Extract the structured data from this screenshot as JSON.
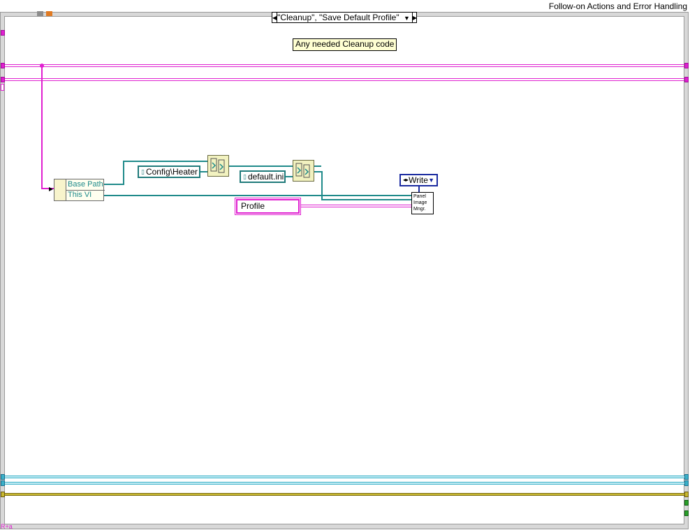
{
  "window": {
    "title": "Follow-on Actions and Error Handling"
  },
  "case_selector": {
    "value": "\"Cleanup\", \"Save Default Profile\"",
    "prev_icon": "triangle-left-icon",
    "next_icon": "triangle-right-icon",
    "dropdown_icon": "triangle-down-icon"
  },
  "comment": {
    "text": "Any needed Cleanup code"
  },
  "property_node": {
    "properties": [
      "Base Path",
      "This VI"
    ]
  },
  "path_constants": {
    "config_heater": "Config\\Heater",
    "default_ini": "default.ini"
  },
  "string_constant": {
    "value": "Profile"
  },
  "enum_constant": {
    "value": "Write"
  },
  "subvi": {
    "label": "Panel Image Mngr."
  },
  "corner_label": {
    "text": "R+a"
  },
  "colors": {
    "string_wire": "#e020d0",
    "path_wire": "#1f8a8a",
    "enum_border": "#1a2aa0",
    "comment_bg": "#ffffd2",
    "error_wire": "#c8b830"
  }
}
